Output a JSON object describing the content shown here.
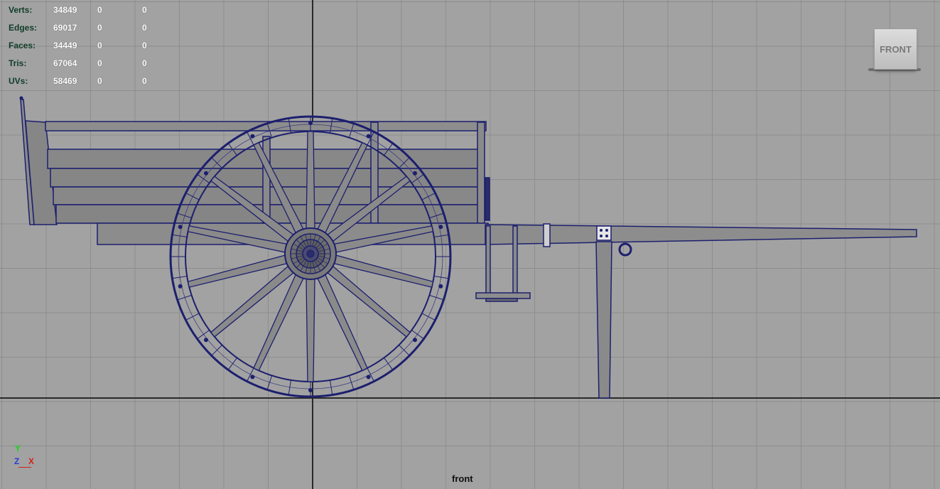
{
  "hud": {
    "rows": [
      {
        "label": "Verts:",
        "v1": "34849",
        "v2": "0",
        "v3": "0"
      },
      {
        "label": "Edges:",
        "v1": "69017",
        "v2": "0",
        "v3": "0"
      },
      {
        "label": "Faces:",
        "v1": "34449",
        "v2": "0",
        "v3": "0"
      },
      {
        "label": "Tris:",
        "v1": "67064",
        "v2": "0",
        "v3": "0"
      },
      {
        "label": "UVs:",
        "v1": "58469",
        "v2": "0",
        "v3": "0"
      }
    ]
  },
  "view_cube": {
    "label": "FRONT"
  },
  "axis_gizmo": {
    "y": "Y",
    "z": "Z",
    "x": "X"
  },
  "camera": {
    "name": "front"
  },
  "colors": {
    "viewport_bg": "#a2a2a2",
    "grid_line": "#8d8d8d",
    "wireframe": "#1c1f6e",
    "mesh_fill": "#8a8a8a",
    "hud_label": "#0f3c28",
    "hud_value": "#ffffff"
  }
}
